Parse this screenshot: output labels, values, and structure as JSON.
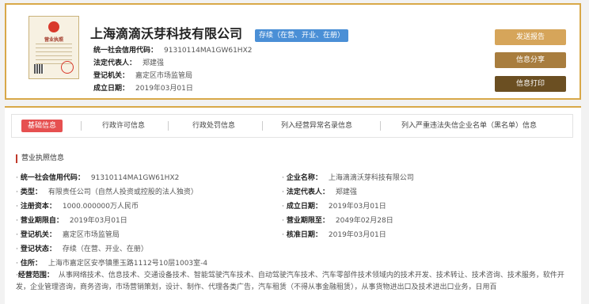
{
  "header": {
    "company_name": "上海滴滴沃芽科技有限公司",
    "status": "存续（在营、开业、在册）",
    "rows": [
      {
        "label": "统一社会信用代码：",
        "value": "91310114MA1GW61HX2"
      },
      {
        "label": "法定代表人：",
        "value": "郑建强"
      },
      {
        "label": "登记机关：",
        "value": "嘉定区市场监管局"
      },
      {
        "label": "成立日期：",
        "value": "2019年03月01日"
      }
    ],
    "license_text": "营业执照"
  },
  "buttons": {
    "report": "发送报告",
    "share": "信息分享",
    "print": "信息打印"
  },
  "tabs": [
    "基础信息",
    "行政许可信息",
    "行政处罚信息",
    "列入经营异常名录信息",
    "列入严重违法失信企业名单（黑名单）信息"
  ],
  "section_title": "营业执照信息",
  "fields_left": [
    {
      "label": "统一社会信用代码：",
      "value": "91310114MA1GW61HX2"
    },
    {
      "label": "类型：",
      "value": "有限责任公司（自然人投资或控股的法人独资）"
    },
    {
      "label": "注册资本：",
      "value": "1000.000000万人民币"
    },
    {
      "label": "营业期限自：",
      "value": "2019年03月01日"
    },
    {
      "label": "登记机关：",
      "value": "嘉定区市场监管局"
    },
    {
      "label": "登记状态：",
      "value": "存续（在营、开业、在册）"
    },
    {
      "label": "住所：",
      "value": "上海市嘉定区安亭镇墨玉路1112号10层1003室-4"
    }
  ],
  "fields_right": [
    {
      "label": "企业名称：",
      "value": "上海滴滴沃芽科技有限公司"
    },
    {
      "label": "法定代表人：",
      "value": "郑建强"
    },
    {
      "label": "成立日期：",
      "value": "2019年03月01日"
    },
    {
      "label": "营业期限至：",
      "value": "2049年02月28日"
    },
    {
      "label": "核准日期：",
      "value": "2019年03月01日"
    }
  ],
  "scope": {
    "label": "经营范围：",
    "value": "从事网络技术、信息技术、交通设备技术、智能驾驶汽车技术、自动驾驶汽车技术、汽车零部件技术领域内的技术开发、技术转让、技术咨询、技术服务，软件开发，企业管理咨询，商务咨询，市场营销策划，设计、制作、代理各类广告，汽车租赁（不得从事金融租赁），从事货物进出口及技术进出口业务，日用百"
  }
}
